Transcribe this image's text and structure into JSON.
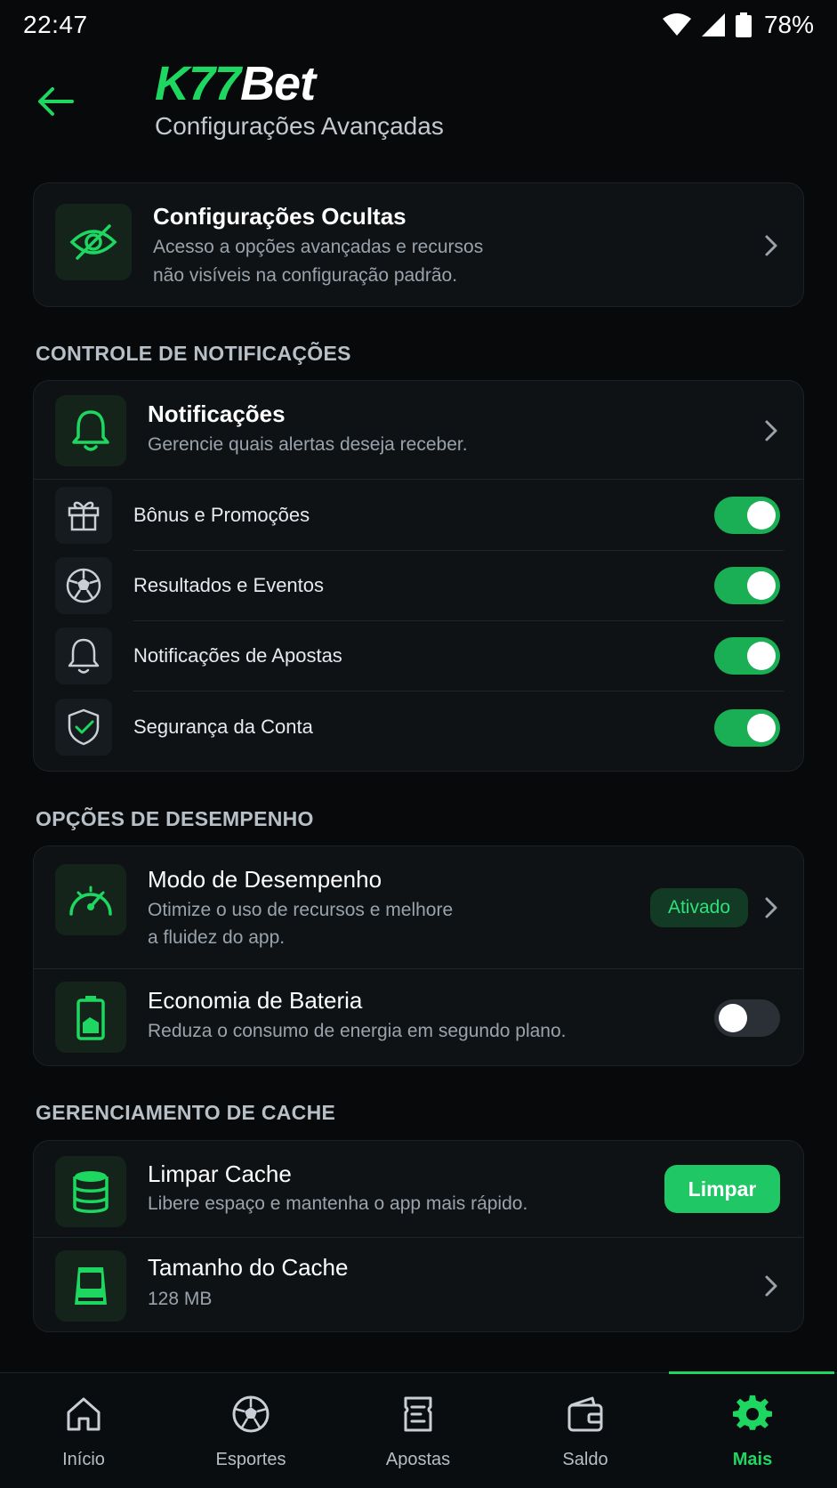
{
  "status_bar": {
    "time": "22:47",
    "battery": "78%"
  },
  "header": {
    "logo_part1": "K77",
    "logo_part2": "Bet",
    "subtitle": "Configurações Avançadas"
  },
  "hidden_settings": {
    "title": "Configurações Ocultas",
    "line1": "Acesso a opções avançadas e recursos",
    "line2": "não visíveis na configuração padrão.",
    "icon": "eye-slash-icon"
  },
  "notifications_section": {
    "header": "CONTROLE DE NOTIFICAÇÕES",
    "main": {
      "title": "Notificações",
      "subtitle": "Gerencie quais alertas deseja receber.",
      "icon": "bell-icon"
    },
    "items": [
      {
        "label": "Bônus e Promoções",
        "icon": "gift-icon",
        "enabled": true
      },
      {
        "label": "Resultados e Eventos",
        "icon": "soccer-ball-icon",
        "enabled": true
      },
      {
        "label": "Notificações de Apostas",
        "icon": "bell-icon",
        "enabled": true
      },
      {
        "label": "Segurança da Conta",
        "icon": "shield-check-icon",
        "enabled": true
      }
    ]
  },
  "performance_section": {
    "header": "OPÇÕES DE DESEMPENHO",
    "mode": {
      "title": "Modo de Desempenho",
      "line1": "Otimize o uso de recursos e melhore",
      "line2": "a fluidez do app.",
      "badge": "Ativado",
      "icon": "speedometer-icon"
    },
    "battery": {
      "title": "Economia de Bateria",
      "subtitle": "Reduza o consumo de energia em segundo plano.",
      "enabled": false,
      "icon": "battery-icon"
    }
  },
  "cache_section": {
    "header": "GERENCIAMENTO DE CACHE",
    "clear": {
      "title": "Limpar Cache",
      "subtitle": "Libere espaço e mantenha o app mais rápido.",
      "button": "Limpar",
      "icon": "database-icon"
    },
    "size": {
      "title": "Tamanho do Cache",
      "value": "128 MB",
      "icon": "storage-drive-icon"
    }
  },
  "bottom_nav": {
    "items": [
      {
        "label": "Início",
        "icon": "home-icon"
      },
      {
        "label": "Esportes",
        "icon": "soccer-ball-icon"
      },
      {
        "label": "Apostas",
        "icon": "ticket-icon"
      },
      {
        "label": "Saldo",
        "icon": "wallet-icon"
      },
      {
        "label": "Mais",
        "icon": "gear-icon",
        "active": true
      }
    ]
  },
  "colors": {
    "accent": "#1ed760",
    "background": "#07090b",
    "card": "#0e1215",
    "toggle_on": "#1aaf54"
  }
}
